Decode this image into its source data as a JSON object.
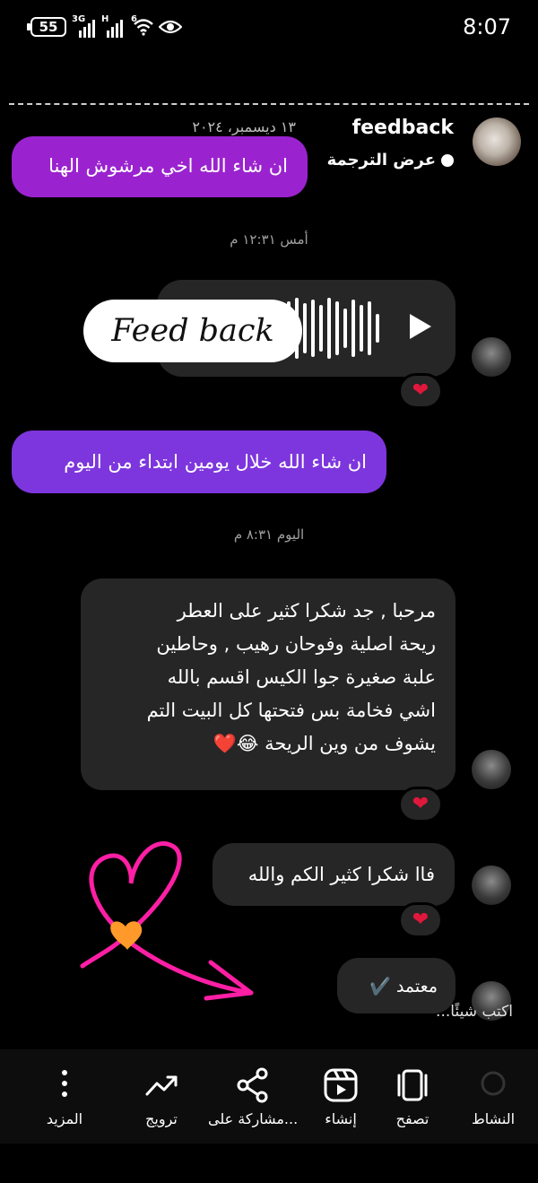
{
  "status_bar": {
    "time": "8:07",
    "battery": "55",
    "signal_1": "3G",
    "signal_2": "H",
    "wifi": "6"
  },
  "header": {
    "username": "feedback",
    "date": "١٣ ديسمبر، ٢٠٢٤",
    "translate_label": "عرض الترجمة"
  },
  "messages": {
    "m1": "ان شاء الله اخي مرشوش الهنا",
    "ts_yesterday": "أمس ١٢:٣١ م",
    "sticker_text": "Feed back",
    "m2": "ان شاء الله خلال يومين ابتداء من اليوم",
    "ts_today": "اليوم ٨:٣١ م",
    "m3_lines": [
      "مرحبا , جد شكرا كثير على العطر",
      "ريحة اصلية وفوحان رهيب , وحاطين",
      "علبة صغيرة جوا الكيس اقسم بالله",
      "اشي فخامة بس فتحتها كل البيت التم",
      "يشوف من وين الريحة 😂❤️"
    ],
    "m4": "فاا شكرا كثير الكم والله",
    "m5": "معتمد ✔️",
    "reaction": "❤"
  },
  "composer": {
    "placeholder": "اكتب شيئًا..."
  },
  "bottom_nav": {
    "activity": "النشاط",
    "browse": "تصفح",
    "create": "إنشاء",
    "share": "مشاركة على...",
    "promote": "ترويج",
    "more": "المزيد"
  },
  "colors": {
    "purple_1": "#9b23cf",
    "purple_2": "#7d36dd",
    "gray_bubble": "#262626",
    "heart": "#e0183b",
    "doodle_pink": "#ff1fa5"
  }
}
